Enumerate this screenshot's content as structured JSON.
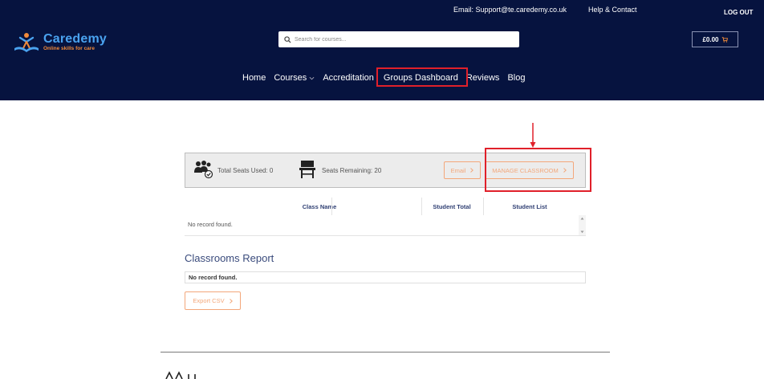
{
  "header": {
    "email_text": "Email: Support@te.caredemy.co.uk",
    "help_label": "Help & Contact",
    "logout_label": "LOG OUT",
    "logo": {
      "name": "Caredemy",
      "tagline": "Online skills for care"
    },
    "search": {
      "placeholder": "Search for courses..."
    },
    "cart": {
      "amount": "£0.00"
    },
    "colors": {
      "background": "#06133f",
      "logo_blue": "#4aa3f0",
      "accent_orange": "#f08a3a"
    }
  },
  "nav": {
    "items": [
      {
        "label": "Home"
      },
      {
        "label": "Courses"
      },
      {
        "label": "Accreditation"
      },
      {
        "label": "Groups Dashboard"
      },
      {
        "label": "Reviews"
      },
      {
        "label": "Blog"
      }
    ]
  },
  "seats": {
    "used_label": "Total Seats Used: 0",
    "remaining_label": "Seats Remaining: 20",
    "email_button": "Email",
    "manage_button": "MANAGE CLASSROOM"
  },
  "classes_table": {
    "columns": [
      "Class Name",
      "Student Total",
      "Student List"
    ],
    "empty_text": "No record found."
  },
  "report": {
    "title": "Classrooms Report",
    "empty_text": "No record found.",
    "export_button": "Export CSV"
  },
  "annotation_color": "#e0202a"
}
